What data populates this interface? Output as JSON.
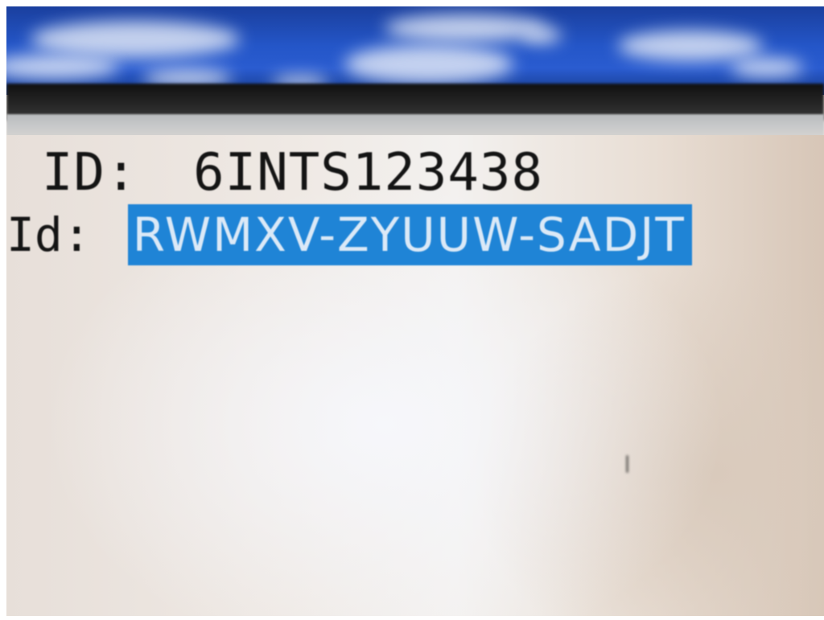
{
  "window": {
    "title": "",
    "wallpaper": "sky-with-clouds"
  },
  "fields": {
    "upper_label": "ID:",
    "upper_value": "6INTS123438",
    "lower_label": "Id:",
    "lower_value": "RWMXV-ZYUUW-SADJT",
    "lower_value_selected": true
  },
  "colors": {
    "selection_background": "#1f84d6",
    "selection_text": "#dbe9f7",
    "text": "#141414",
    "wallpaper_sky": "#2456c8"
  }
}
